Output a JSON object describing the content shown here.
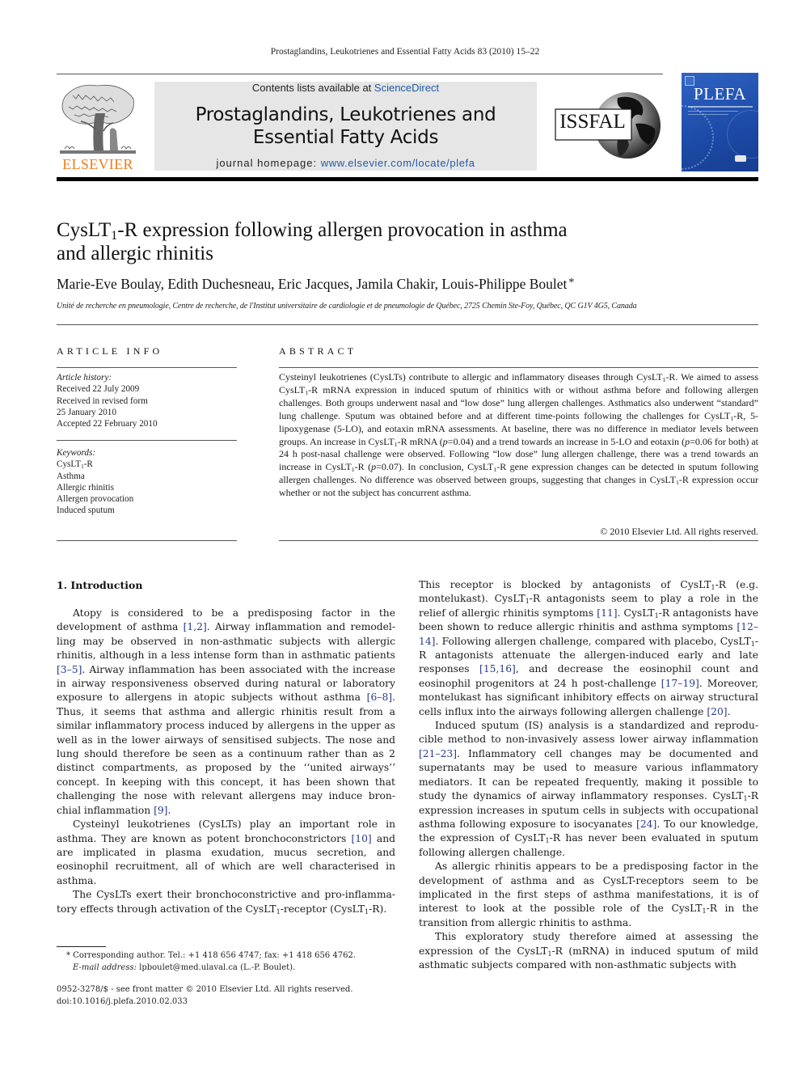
{
  "running_head": "Prostaglandins, Leukotrienes and Essential Fatty Acids 83 (2010) 15–22",
  "header": {
    "publisher_logo_text": "ELSEVIER",
    "contents_prefix": "Contents lists available at ",
    "contents_link": "ScienceDirect",
    "journal_title_line1": "Prostaglandins, Leukotrienes and",
    "journal_title_line2": "Essential Fatty Acids",
    "homepage_prefix": "journal homepage: ",
    "homepage_link": "www.elsevier.com/locate/plefa",
    "society_logo_text": "ISSFAL",
    "cover_title": "PLEFA",
    "colors": {
      "elsevier_orange": "#f07c1b",
      "link_blue": "#1f5aa6",
      "box_gray": "#e6e6e6",
      "cover_blue": "#1c4aa6"
    }
  },
  "article": {
    "title": [
      {
        "t": "CysLT"
      },
      {
        "sub": "1"
      },
      {
        "t": "-R expression following allergen provocation in asthma"
      },
      {
        "br": true
      },
      {
        "t": "and allergic rhinitis"
      }
    ],
    "authors": "Marie-Eve Boulay, Edith Duchesneau, Eric Jacques, Jamila Chakir, Louis-Philippe Boulet",
    "corresponding_marker": "*",
    "affiliation": "Unité de recherche en pneumologie, Centre de recherche, de l'Institut universitaire de cardiologie et de pneumologie de Québec, 2725 Chemin Ste-Foy, Québec, QC G1V 4G5, Canada"
  },
  "article_info": {
    "heading": "ARTICLE INFO",
    "history_label": "Article history:",
    "history": [
      "Received 22 July 2009",
      "Received in revised form",
      "25 January 2010",
      "Accepted 22 February 2010"
    ],
    "keywords_label": "Keywords:",
    "keywords": [
      [
        {
          "t": "CysLT"
        },
        {
          "sub": "1"
        },
        {
          "t": "-R"
        }
      ],
      [
        {
          "t": "Asthma"
        }
      ],
      [
        {
          "t": "Allergic rhinitis"
        }
      ],
      [
        {
          "t": "Allergen provocation"
        }
      ],
      [
        {
          "t": "Induced sputum"
        }
      ]
    ]
  },
  "abstract": {
    "heading": "ABSTRACT",
    "text": [
      {
        "t": "Cysteinyl leukotrienes (CysLTs) contribute to allergic and inflammatory diseases through CysLT"
      },
      {
        "sub": "1"
      },
      {
        "t": "-R. We aimed to assess CysLT"
      },
      {
        "sub": "1"
      },
      {
        "t": "-R mRNA expression in induced sputum of rhinitics with or without asthma before and following allergen challenges. Both groups underwent nasal and “low dose” lung allergen challenges. Asthmatics also underwent “standard” lung challenge. Sputum was obtained before and at different time-points following the challenges for CysLT"
      },
      {
        "sub": "1"
      },
      {
        "t": "-R, 5-lipoxygenase (5-LO), and eotaxin mRNA assessments. At baseline, there was no difference in mediator levels between groups. An increase in CysLT"
      },
      {
        "sub": "1"
      },
      {
        "t": "-R mRNA ("
      },
      {
        "i": "p"
      },
      {
        "t": "=0.04) and a trend towards an increase in 5-LO and eotaxin ("
      },
      {
        "i": "p"
      },
      {
        "t": "=0.06 for both) at 24 h post-nasal challenge were observed. Following “low dose” lung allergen challenge, there was a trend towards an increase in CysLT"
      },
      {
        "sub": "1"
      },
      {
        "t": "-R ("
      },
      {
        "i": "p"
      },
      {
        "t": "=0.07). In conclusion, CysLT"
      },
      {
        "sub": "1"
      },
      {
        "t": "-R gene expression changes can be detected in sputum following allergen challenges. No difference was observed between groups, suggesting that changes in CysLT"
      },
      {
        "sub": "1"
      },
      {
        "t": "-R expression occur whether or not the subject has concurrent asthma."
      }
    ],
    "copyright": "© 2010 Elsevier Ltd. All rights reserved."
  },
  "introduction": {
    "heading": "1.  Introduction",
    "left_column": [
      [
        {
          "t": "Atopy is considered to be a predisposing factor in the development of asthma "
        },
        {
          "cite": "[1,2]"
        },
        {
          "t": ". Airway inflammation and remodel-ling may be observed in non-asthmatic subjects with allergic rhinitis, although in a less intense form than in asthmatic patients "
        },
        {
          "cite": "[3–5]"
        },
        {
          "t": ". Airway inflammation has been associated with the increase in airway responsiveness observed during natural or laboratory exposure to allergens in atopic subjects without asthma "
        },
        {
          "cite": "[6–8]"
        },
        {
          "t": ". Thus, it seems that asthma and allergic rhinitis result from a similar inflammatory process induced by allergens in the upper as well as in the lower airways of sensitised subjects. The nose and lung should therefore be seen as a continuum rather than as 2 distinct compartments, as proposed by the ‘‘united airways’’ concept. In keeping with this concept, it has been shown that challenging the nose with relevant allergens may induce bron-chial inflammation "
        },
        {
          "cite": "[9]"
        },
        {
          "t": "."
        }
      ],
      [
        {
          "t": "Cysteinyl leukotrienes (CysLTs) play an important role in asthma. They are known as potent bronchoconstrictors "
        },
        {
          "cite": "[10]"
        },
        {
          "t": " and are implicated in plasma exudation, mucus secretion, and eosinophil recruitment, all of which are well characterised in asthma."
        }
      ],
      [
        {
          "t": "The CysLTs exert their bronchoconstrictive and pro-inflamma-tory effects through activation of the CysLT"
        },
        {
          "sub": "1"
        },
        {
          "t": "-receptor (CysLT"
        },
        {
          "sub": "1"
        },
        {
          "t": "-R)."
        }
      ]
    ],
    "right_column": [
      [
        {
          "t": "This receptor is blocked by antagonists of CysLT"
        },
        {
          "sub": "1"
        },
        {
          "t": "-R (e.g. montelukast). CysLT"
        },
        {
          "sub": "1"
        },
        {
          "t": "-R antagonists seem to play a role in the relief of allergic rhinitis symptoms "
        },
        {
          "cite": "[11]"
        },
        {
          "t": ". CysLT"
        },
        {
          "sub": "1"
        },
        {
          "t": "-R antagonists have been shown to reduce allergic rhinitis and asthma symptoms "
        },
        {
          "cite": "[12–14]"
        },
        {
          "t": ". Following allergen challenge, compared with placebo, CysLT"
        },
        {
          "sub": "1"
        },
        {
          "t": "-R antagonists attenuate the allergen-induced early and late responses "
        },
        {
          "cite": "[15,16]"
        },
        {
          "t": ", and decrease the eosinophil count and eosinophil progenitors at 24 h post-challenge "
        },
        {
          "cite": "[17–19]"
        },
        {
          "t": ". Moreover, montelukast has significant inhibitory effects on airway structural cells influx into the airways following allergen challenge "
        },
        {
          "cite": "[20]"
        },
        {
          "t": "."
        }
      ],
      [
        {
          "t": "Induced sputum (IS) analysis is a standardized and reprodu-cible method to non-invasively assess lower airway inflammation "
        },
        {
          "cite": "[21–23]"
        },
        {
          "t": ". Inflammatory cell changes may be documented and supernatants may be used to measure various inflammatory mediators. It can be repeated frequently, making it possible to study the dynamics of airway inflammatory responses. CysLT"
        },
        {
          "sub": "1"
        },
        {
          "t": "-R expression increases in sputum cells in subjects with occupational asthma following exposure to isocyanates "
        },
        {
          "cite": "[24]"
        },
        {
          "t": ". To our knowledge, the expression of CysLT"
        },
        {
          "sub": "1"
        },
        {
          "t": "-R has never been evaluated in sputum following allergen challenge."
        }
      ],
      [
        {
          "t": "As allergic rhinitis appears to be a predisposing factor in the development of asthma and as CysLT-receptors seem to be implicated in the first steps of asthma manifestations, it is of interest to look at the possible role of the CysLT"
        },
        {
          "sub": "1"
        },
        {
          "t": "-R in the transition from allergic rhinitis to asthma."
        }
      ],
      [
        {
          "t": "This exploratory study therefore aimed at assessing the expression of the CysLT"
        },
        {
          "sub": "1"
        },
        {
          "t": "-R (mRNA) in induced sputum of mild asthmatic subjects compared with non-asthmatic subjects with"
        }
      ]
    ]
  },
  "footnotes": {
    "corresponding": "* Corresponding author. Tel.: +1 418 656 4747; fax: +1 418 656 4762.",
    "email_label": "E-mail address:",
    "email_value": " lpboulet@med.ulaval.ca (L.-P. Boulet).",
    "front_matter": "0952-3278/$ - see front matter © 2010 Elsevier Ltd. All rights reserved.",
    "doi": "doi:10.1016/j.plefa.2010.02.033"
  }
}
